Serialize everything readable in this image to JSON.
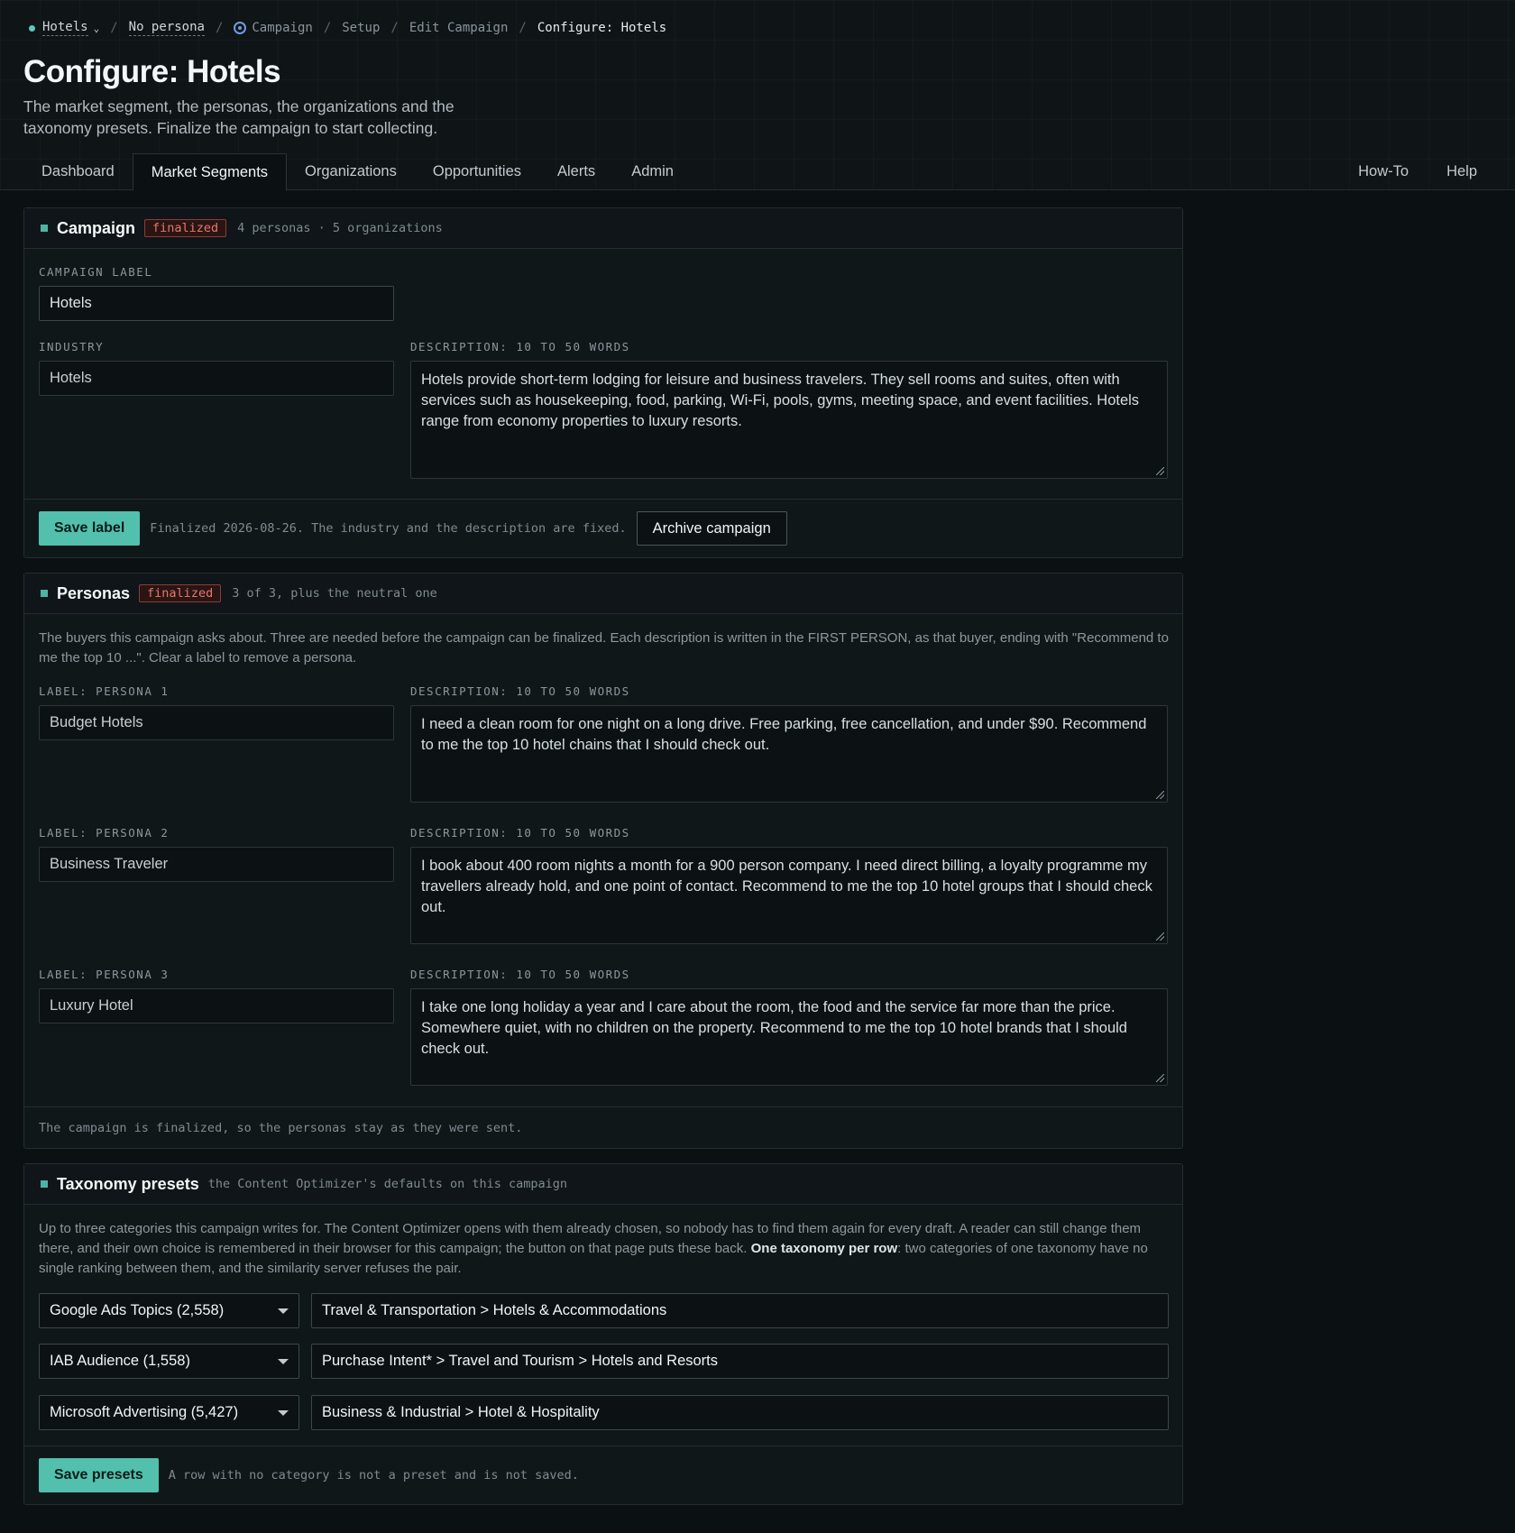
{
  "breadcrumb": {
    "campaign_selector": "Hotels",
    "persona_selector": "No persona",
    "items": [
      "Campaign",
      "Setup",
      "Edit Campaign"
    ],
    "current": "Configure: Hotels",
    "separator": "/"
  },
  "page": {
    "title": "Configure: Hotels",
    "subtitle": "The market segment, the personas, the organizations and the taxonomy presets. Finalize the campaign to start collecting."
  },
  "tabs": {
    "left": [
      "Dashboard",
      "Market Segments",
      "Organizations",
      "Opportunities",
      "Alerts",
      "Admin"
    ],
    "active": "Market Segments",
    "right": [
      "How-To",
      "Help"
    ]
  },
  "campaign": {
    "title": "Campaign",
    "badge": "finalized",
    "meta": "4 personas · 5 organizations",
    "label_caption": "CAMPAIGN LABEL",
    "label_value": "Hotels",
    "industry_caption": "INDUSTRY",
    "industry_value": "Hotels",
    "description_caption": "DESCRIPTION: 10 TO 50 WORDS",
    "description_value": "Hotels provide short-term lodging for leisure and business travelers. They sell rooms and suites, often with services such as housekeeping, food, parking, Wi-Fi, pools, gyms, meeting space, and event facilities. Hotels range from economy properties to luxury resorts.",
    "save_button": "Save label",
    "footer_note": "Finalized 2026-08-26. The industry and the description are fixed.",
    "archive_button": "Archive campaign"
  },
  "personas": {
    "title": "Personas",
    "badge": "finalized",
    "meta": "3 of 3, plus the neutral one",
    "help": "The buyers this campaign asks about. Three are needed before the campaign can be finalized. Each description is written in the FIRST PERSON, as that buyer, ending with \"Recommend to me the top 10 ...\". Clear a label to remove a persona.",
    "description_caption": "DESCRIPTION: 10 TO 50 WORDS",
    "items": [
      {
        "label_caption": "LABEL: PERSONA 1",
        "label": "Budget Hotels",
        "description": "I need a clean room for one night on a long drive. Free parking, free cancellation, and under $90. Recommend to me the top 10 hotel chains that I should check out."
      },
      {
        "label_caption": "LABEL: PERSONA 2",
        "label": "Business Traveler",
        "description": "I book about 400 room nights a month for a 900 person company. I need direct billing, a loyalty programme my travellers already hold, and one point of contact. Recommend to me the top 10 hotel groups that I should check out."
      },
      {
        "label_caption": "LABEL: PERSONA 3",
        "label": "Luxury Hotel",
        "description": "I take one long holiday a year and I care about the room, the food and the service far more than the price. Somewhere quiet, with no children on the property. Recommend to me the top 10 hotel brands that I should check out."
      }
    ],
    "footer_note": "The campaign is finalized, so the personas stay as they were sent."
  },
  "taxonomy": {
    "title": "Taxonomy presets",
    "meta": "the Content Optimizer's defaults on this campaign",
    "help_prefix": "Up to three categories this campaign writes for. The Content Optimizer opens with them already chosen, so nobody has to find them again for every draft. A reader can still change them there, and their own choice is remembered in their browser for this campaign; the button on that page puts these back. ",
    "help_bold": "One taxonomy per row",
    "help_suffix": ": two categories of one taxonomy have no single ranking between them, and the similarity server refuses the pair.",
    "rows": [
      {
        "taxonomy": "Google Ads Topics (2,558)",
        "category": "Travel & Transportation > Hotels & Accommodations"
      },
      {
        "taxonomy": "IAB Audience (1,558)",
        "category": "Purchase Intent* > Travel and Tourism > Hotels and Resorts"
      },
      {
        "taxonomy": "Microsoft Advertising (5,427)",
        "category": "Business & Industrial > Hotel & Hospitality"
      }
    ],
    "save_button": "Save presets",
    "footer_note": "A row with no category is not a preset and is not saved."
  },
  "colors": {
    "background": "#0b1013",
    "accent": "#52c0ad",
    "badge": "#e7776c",
    "link_icon": "#6f9ce0"
  }
}
